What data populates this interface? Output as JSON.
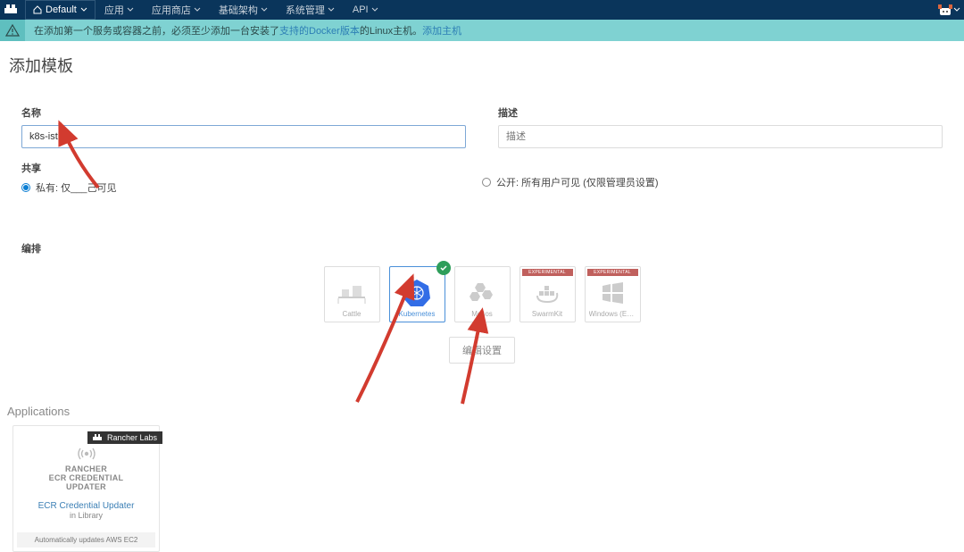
{
  "nav": {
    "env_label": "Default",
    "items": [
      {
        "label": "应用"
      },
      {
        "label": "应用商店"
      },
      {
        "label": "基础架构"
      },
      {
        "label": "系统管理"
      },
      {
        "label": "API"
      }
    ]
  },
  "banner": {
    "prefix": "在添加第一个服务或容器之前，必须至少添加一台安装了",
    "link1": "支持的Docker版本",
    "mid": "的Linux主机。",
    "link2": "添加主机"
  },
  "page": {
    "title": "添加模板",
    "name_label": "名称",
    "name_value": "k8s-istio",
    "desc_label": "描述",
    "desc_placeholder": "描述",
    "share_label": "共享",
    "share_private": "私有: 仅___己可见",
    "share_public": "公开: 所有用户可见 (仅限管理员设置)",
    "orch_label": "编排",
    "orch": [
      {
        "name": "Cattle",
        "experimental": false,
        "selected": false
      },
      {
        "name": "Kubernetes",
        "experimental": false,
        "selected": true
      },
      {
        "name": "Mesos",
        "experimental": false,
        "selected": false
      },
      {
        "name": "SwarmKit",
        "experimental": true,
        "selected": false
      },
      {
        "name": "Windows (Ex...",
        "experimental": true,
        "selected": false
      }
    ],
    "edit_settings": "编辑设置"
  },
  "apps": {
    "header": "Applications",
    "ribbon": "Rancher Labs",
    "logo_line1": "RANCHER",
    "logo_line2": "ECR CREDENTIAL",
    "logo_line3": "UPDATER",
    "title": "ECR Credential Updater",
    "sub": "in Library",
    "desc": "Automatically updates AWS EC2"
  },
  "colors": {
    "navbar": "#0a355b",
    "banner": "#7fd2d2",
    "accent": "#4a90d9",
    "danger_arrow": "#d23b2f",
    "green": "#2e9e5b"
  }
}
